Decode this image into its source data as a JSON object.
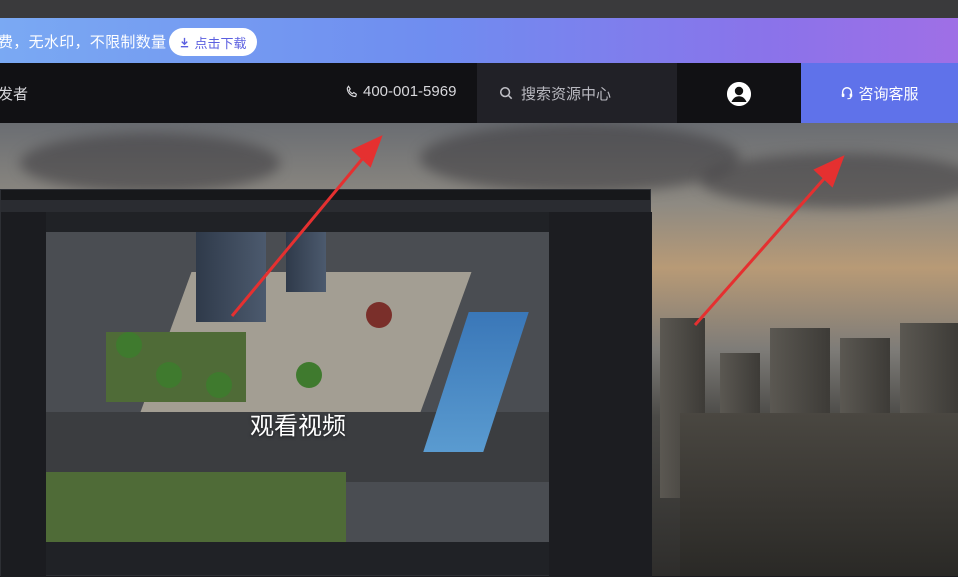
{
  "banner": {
    "text": "费，无水印，不限制数量",
    "download_label": "点击下载"
  },
  "nav": {
    "left_text": "发者",
    "phone": "400-001-5969",
    "search_placeholder": "搜索资源中心",
    "consult_label": "咨询客服"
  },
  "hero": {
    "video_label": "观看视频"
  },
  "colors": {
    "banner_start": "#7aa9f3",
    "banner_end": "#9f6fe6",
    "nav_bg": "#111114",
    "consult_bg": "#5f72ea",
    "arrow": "#e53030"
  }
}
